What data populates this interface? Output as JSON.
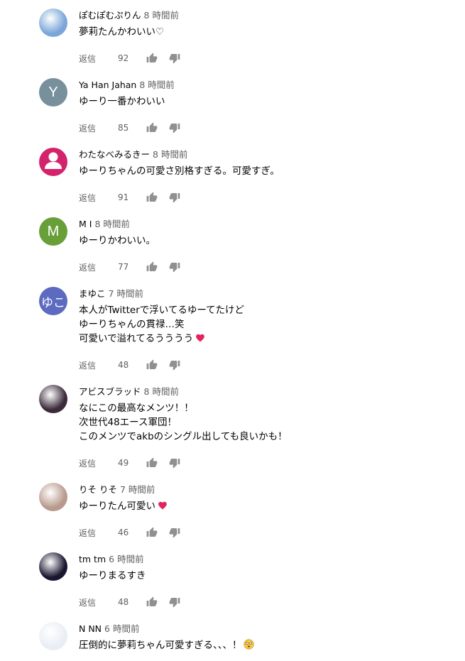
{
  "comments": [
    {
      "author": "ぽむぽむぷりん",
      "time": "8 時間前",
      "lines": [
        "夢莉たんかわいい♡"
      ],
      "reply": "返信",
      "likes": "92",
      "avatar": {
        "kind": "photo",
        "letter": "",
        "color": "#7aa6d8"
      }
    },
    {
      "author": "Ya Han Jahan",
      "time": "8 時間前",
      "lines": [
        "ゆーり一番かわいい"
      ],
      "reply": "返信",
      "likes": "85",
      "avatar": {
        "kind": "letter",
        "letter": "Y",
        "color": "#78909c"
      }
    },
    {
      "author": "わたなべみるきー",
      "time": "8 時間前",
      "lines": [
        "ゆーりちゃんの可愛さ別格すぎる。可愛すぎ。"
      ],
      "reply": "返信",
      "likes": "91",
      "avatar": {
        "kind": "person",
        "letter": "",
        "color": "#d4236d"
      }
    },
    {
      "author": "M I",
      "time": "8 時間前",
      "lines": [
        "ゆーりかわいい。"
      ],
      "reply": "返信",
      "likes": "77",
      "avatar": {
        "kind": "letter",
        "letter": "M",
        "color": "#689f38"
      }
    },
    {
      "author": "まゆこ",
      "time": "7 時間前",
      "lines": [
        "本人がTwitterで浮いてるゆーてたけど",
        "ゆーりちゃんの貫禄…笑",
        "可愛いで溢れてるうううう"
      ],
      "reply": "返信",
      "likes": "48",
      "avatar": {
        "kind": "letter",
        "letter": "ゆこ",
        "color": "#5c6bc0"
      },
      "heart_line": 2
    },
    {
      "author": "アビスブラッド",
      "time": "8 時間前",
      "lines": [
        "なにこの最高なメンツ！！",
        "次世代48エース軍団！",
        "このメンツでakbのシングル出しても良いかも！"
      ],
      "reply": "返信",
      "likes": "49",
      "avatar": {
        "kind": "photo",
        "letter": "",
        "color": "#3b2a3a"
      }
    },
    {
      "author": "りそ りそ",
      "time": "7 時間前",
      "lines": [
        "ゆーりたん可愛い"
      ],
      "reply": "返信",
      "likes": "46",
      "avatar": {
        "kind": "photo",
        "letter": "",
        "color": "#b89a8c"
      },
      "heart_line": 0
    },
    {
      "author": "tm tm",
      "time": "6 時間前",
      "lines": [
        "ゆーりまるすき"
      ],
      "reply": "返信",
      "likes": "48",
      "avatar": {
        "kind": "photo",
        "letter": "",
        "color": "#1a1630"
      }
    },
    {
      "author": "N NN",
      "time": "6 時間前",
      "lines": [
        "圧倒的に夢莉ちゃん可愛すぎる、、、！"
      ],
      "reply": "",
      "likes": "",
      "avatar": {
        "kind": "photo",
        "letter": "",
        "color": "#e9eef4"
      },
      "face_line": 0
    }
  ],
  "icons": {
    "like": "thumb-up-icon",
    "dislike": "thumb-down-icon",
    "heart": "heart-icon",
    "face": "flushed-face-icon"
  },
  "colors": {
    "secondary_text": "#606060",
    "icon_gray": "#909090",
    "heart": "#e0245e"
  }
}
